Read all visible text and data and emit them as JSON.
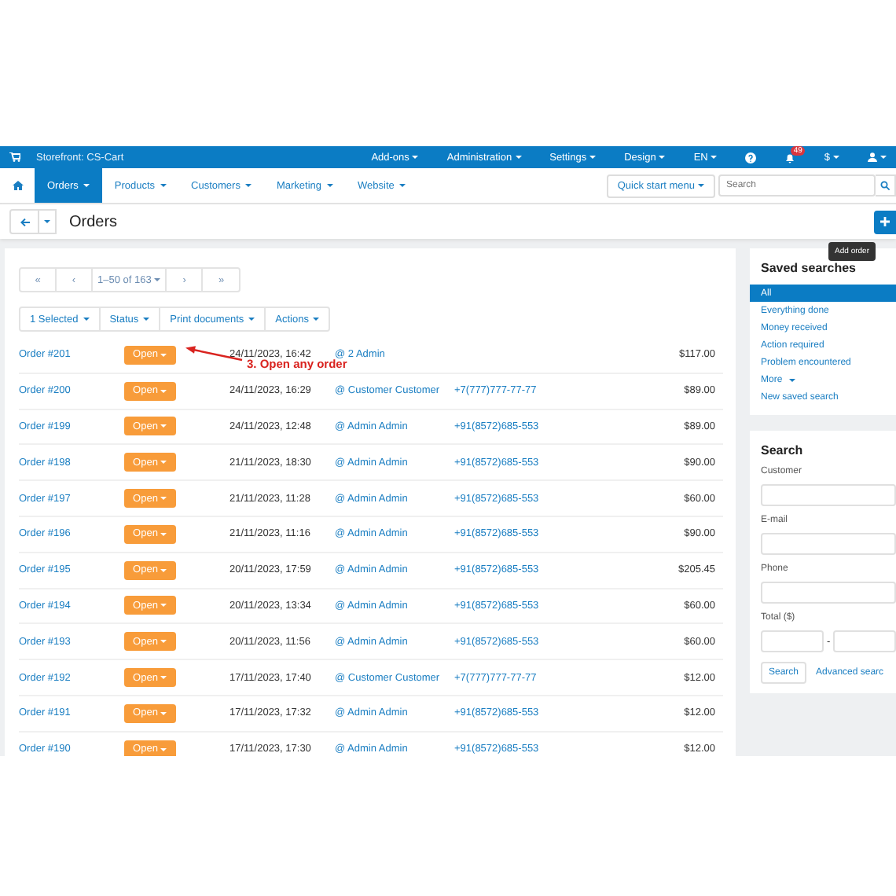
{
  "top_bar": {
    "storefront": "Storefront: CS-Cart",
    "menus": [
      {
        "label": "Add-ons"
      },
      {
        "label": "Administration"
      },
      {
        "label": "Settings"
      },
      {
        "label": "Design"
      },
      {
        "label": "EN"
      }
    ],
    "notifications_badge": "49",
    "currency": "$"
  },
  "nav": {
    "tabs": [
      {
        "label": "Orders",
        "selected": true
      },
      {
        "label": "Products",
        "selected": false
      },
      {
        "label": "Customers",
        "selected": false
      },
      {
        "label": "Marketing",
        "selected": false
      },
      {
        "label": "Website",
        "selected": false
      }
    ],
    "quick_start": "Quick start menu",
    "search": {
      "placeholder": "Search"
    }
  },
  "page_header": {
    "title": "Orders",
    "add_tooltip": "Add order"
  },
  "pagination": {
    "first": "«",
    "prev": "‹",
    "range": "1–50 of 163",
    "next": "›",
    "last": "»"
  },
  "bulk_actions": [
    "1 Selected",
    "Status",
    "Print documents",
    "Actions"
  ],
  "orders": [
    {
      "order": "Order #201",
      "status": "Open",
      "date": "24/11/2023, 16:42",
      "customer": "@ 2 Admin",
      "total": "$117.00"
    },
    {
      "order": "Order #200",
      "status": "Open",
      "date": "24/11/2023, 16:29",
      "customer": "@ Customer Customer",
      "phone": "+7(777)777-77-77",
      "total": "$89.00"
    },
    {
      "order": "Order #199",
      "status": "Open",
      "date": "24/11/2023, 12:48",
      "customer": "@ Admin Admin",
      "phone": "+91(8572)685-553",
      "total": "$89.00"
    },
    {
      "order": "Order #198",
      "status": "Open",
      "date": "21/11/2023, 18:30",
      "customer": "@ Admin Admin",
      "phone": "+91(8572)685-553",
      "total": "$90.00"
    },
    {
      "order": "Order #197",
      "status": "Open",
      "date": "21/11/2023, 11:28",
      "customer": "@ Admin Admin",
      "phone": "+91(8572)685-553",
      "total": "$60.00"
    },
    {
      "order": "Order #196",
      "status": "Open",
      "date": "21/11/2023, 11:16",
      "customer": "@ Admin Admin",
      "phone": "+91(8572)685-553",
      "total": "$90.00"
    },
    {
      "order": "Order #195",
      "status": "Open",
      "date": "20/11/2023, 17:59",
      "customer": "@ Admin Admin",
      "phone": "+91(8572)685-553",
      "total": "$205.45"
    },
    {
      "order": "Order #194",
      "status": "Open",
      "date": "20/11/2023, 13:34",
      "customer": "@ Admin Admin",
      "phone": "+91(8572)685-553",
      "total": "$60.00"
    },
    {
      "order": "Order #193",
      "status": "Open",
      "date": "20/11/2023, 11:56",
      "customer": "@ Admin Admin",
      "phone": "+91(8572)685-553",
      "total": "$60.00"
    },
    {
      "order": "Order #192",
      "status": "Open",
      "date": "17/11/2023, 17:40",
      "customer": "@ Customer Customer",
      "phone": "+7(777)777-77-77",
      "total": "$12.00"
    },
    {
      "order": "Order #191",
      "status": "Open",
      "date": "17/11/2023, 17:32",
      "customer": "@ Admin Admin",
      "phone": "+91(8572)685-553",
      "total": "$12.00"
    },
    {
      "order": "Order #190",
      "status": "Open",
      "date": "17/11/2023, 17:30",
      "customer": "@ Admin Admin",
      "phone": "+91(8572)685-553",
      "total": "$12.00"
    }
  ],
  "annotation": {
    "text": "3. Open any order"
  },
  "saved_searches": {
    "title": "Saved searches",
    "items": [
      {
        "label": "All",
        "selected": true
      },
      {
        "label": "Everything done",
        "selected": false
      },
      {
        "label": "Money received",
        "selected": false
      },
      {
        "label": "Action required",
        "selected": false
      },
      {
        "label": "Problem encountered",
        "selected": false
      }
    ],
    "more": "More",
    "new_search": "New saved search"
  },
  "search_panel": {
    "title": "Search",
    "fields": [
      {
        "label": "Customer"
      },
      {
        "label": "E-mail"
      },
      {
        "label": "Phone"
      }
    ],
    "total_label": "Total ($)",
    "range_separator": "-",
    "search_button": "Search",
    "advanced_link": "Advanced searc"
  }
}
